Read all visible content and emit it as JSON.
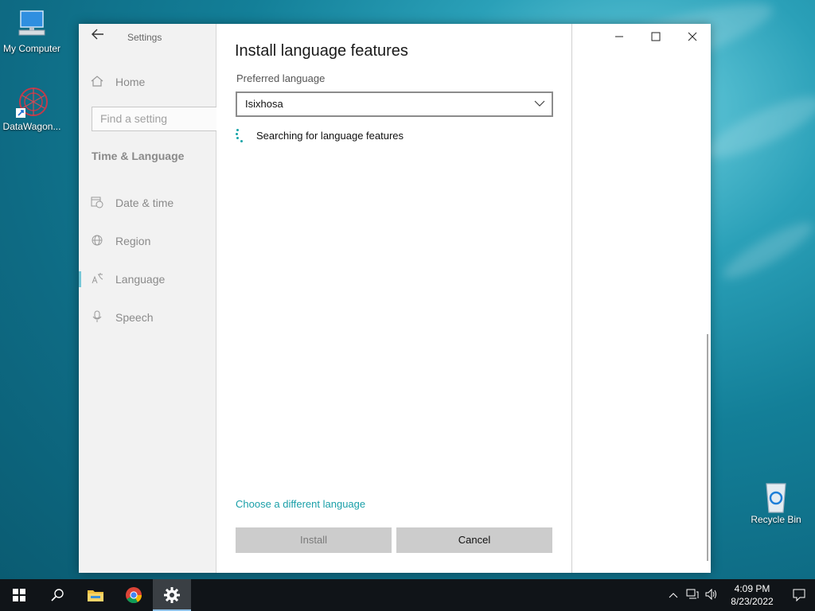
{
  "desktop": {
    "icons": [
      {
        "label": "My Computer"
      },
      {
        "label": "DataWagon..."
      },
      {
        "label": "Recycle Bin"
      }
    ]
  },
  "window": {
    "app_title": "Settings",
    "sidebar": {
      "home": "Home",
      "search_placeholder": "Find a setting",
      "section": "Time & Language",
      "items": [
        {
          "label": "Date & time",
          "icon": "calendar-clock-icon"
        },
        {
          "label": "Region",
          "icon": "globe-icon"
        },
        {
          "label": "Language",
          "icon": "language-icon",
          "active": true
        },
        {
          "label": "Speech",
          "icon": "microphone-icon"
        }
      ]
    },
    "dialog": {
      "title": "Install language features",
      "preferred_label": "Preferred language",
      "selected_language": "Isixhosa",
      "status": "Searching for language features",
      "change_link": "Choose a different language",
      "install_label": "Install",
      "cancel_label": "Cancel"
    }
  },
  "taskbar": {
    "time": "4:09 PM",
    "date": "8/23/2022"
  },
  "colors": {
    "accent": "#1a9fa8",
    "taskbar": "#101418",
    "sidebar": "#f2f2f2"
  }
}
